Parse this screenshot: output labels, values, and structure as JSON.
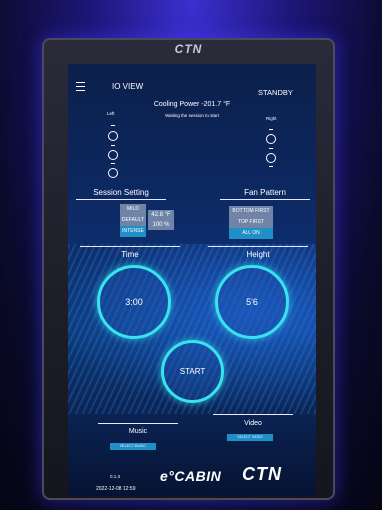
{
  "device": {
    "bezel_logo": "CTN"
  },
  "header": {
    "title": "IO VIEW",
    "status": "STANDBY"
  },
  "cooling": {
    "label": "Cooling Power -201.7 °F",
    "message": "Waiting the session to start"
  },
  "sides": {
    "left": "Left",
    "right": "Right"
  },
  "session": {
    "title": "Session Setting",
    "modes": [
      "MILD",
      "DEFAULT",
      "INTENSE"
    ],
    "selected_mode": "INTENSE",
    "temperature": "42.8 °F",
    "percent": "100 %"
  },
  "fan": {
    "title": "Fan Pattern",
    "options": [
      "BOTTOM FIRST",
      "TOP FIRST",
      "ALL ON"
    ],
    "selected": "ALL ON"
  },
  "time": {
    "title": "Time",
    "value": "3:00"
  },
  "height": {
    "title": "Height",
    "value": "5'6"
  },
  "start_label": "START",
  "music": {
    "title": "Music",
    "button": "SELECT MUSIC"
  },
  "video": {
    "title": "Video",
    "button": "SELECT VIDEO"
  },
  "footer": {
    "version": "0.1.3",
    "datetime": "2022-12-08 12:59",
    "brand": "e°CABIN",
    "logo": "CTN"
  },
  "colors": {
    "accent": "#36e3ef",
    "selected": "#1f8fc7"
  }
}
